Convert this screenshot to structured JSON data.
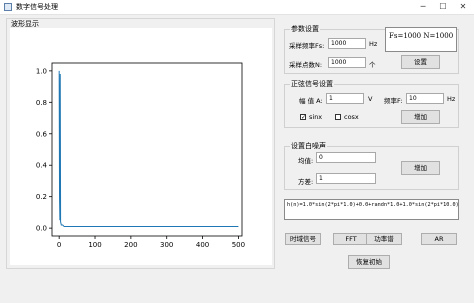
{
  "window": {
    "title": "数字信号处理",
    "minimize_label": "─",
    "maximize_label": "☐",
    "close_label": "✕"
  },
  "wave_panel": {
    "title": "波形显示"
  },
  "params": {
    "title": "参数设置",
    "fs_label": "采样频率Fs:",
    "fs_value": "1000",
    "fs_unit": "Hz",
    "n_label": "采样点数N:",
    "n_value": "1000",
    "n_unit": "个",
    "set_button": "设置",
    "info_text": "Fs=1000 N=1000"
  },
  "sine": {
    "title": "正弦信号设置",
    "amp_label": "幅 值 A:",
    "amp_value": "1",
    "amp_unit": "V",
    "freq_label": "频率F:",
    "freq_value": "10",
    "freq_unit": "Hz",
    "sinx_label": "sinx",
    "sinx_checked": true,
    "cosx_label": "cosx",
    "cosx_checked": false,
    "add_button": "增加"
  },
  "noise": {
    "title": "设置白噪声",
    "mean_label": "均值:",
    "mean_value": "0",
    "var_label": "方差:",
    "var_value": "1",
    "add_button": "增加"
  },
  "formula": "h(n)=1.0*sin(2*pi*1.0)+0.0+randn*1.0+1.0*sin(2*pi*10.0)",
  "actions": {
    "time_signal": "时域信号",
    "fft": "FFT",
    "power_spectrum": "功率谱",
    "ar": "AR"
  },
  "restore_button": "恢复初始",
  "chart_data": {
    "type": "line",
    "title": "",
    "xlabel": "",
    "ylabel": "",
    "xlim": [
      -20,
      510
    ],
    "ylim": [
      -0.05,
      1.05
    ],
    "x_ticks": [
      "0",
      "100",
      "200",
      "300",
      "400",
      "500"
    ],
    "y_ticks": [
      "0.0",
      "0.2",
      "0.4",
      "0.6",
      "0.8",
      "1.0"
    ],
    "x_tick_values": [
      0,
      100,
      200,
      300,
      400,
      500
    ],
    "y_tick_values": [
      0.0,
      0.2,
      0.4,
      0.6,
      0.8,
      1.0
    ],
    "series": [
      {
        "color": "#1f77b4",
        "x": [
          0,
          1,
          2,
          3,
          4,
          5,
          6,
          8,
          10,
          14,
          20,
          30,
          40,
          60,
          80,
          100,
          150,
          200,
          250,
          300,
          350,
          400,
          450,
          500
        ],
        "values": [
          1.0,
          0.2,
          0.05,
          0.98,
          0.04,
          0.03,
          0.02,
          0.02,
          0.02,
          0.01,
          0.01,
          0.01,
          0.01,
          0.01,
          0.01,
          0.01,
          0.01,
          0.01,
          0.01,
          0.01,
          0.01,
          0.01,
          0.01,
          0.01
        ]
      }
    ]
  }
}
